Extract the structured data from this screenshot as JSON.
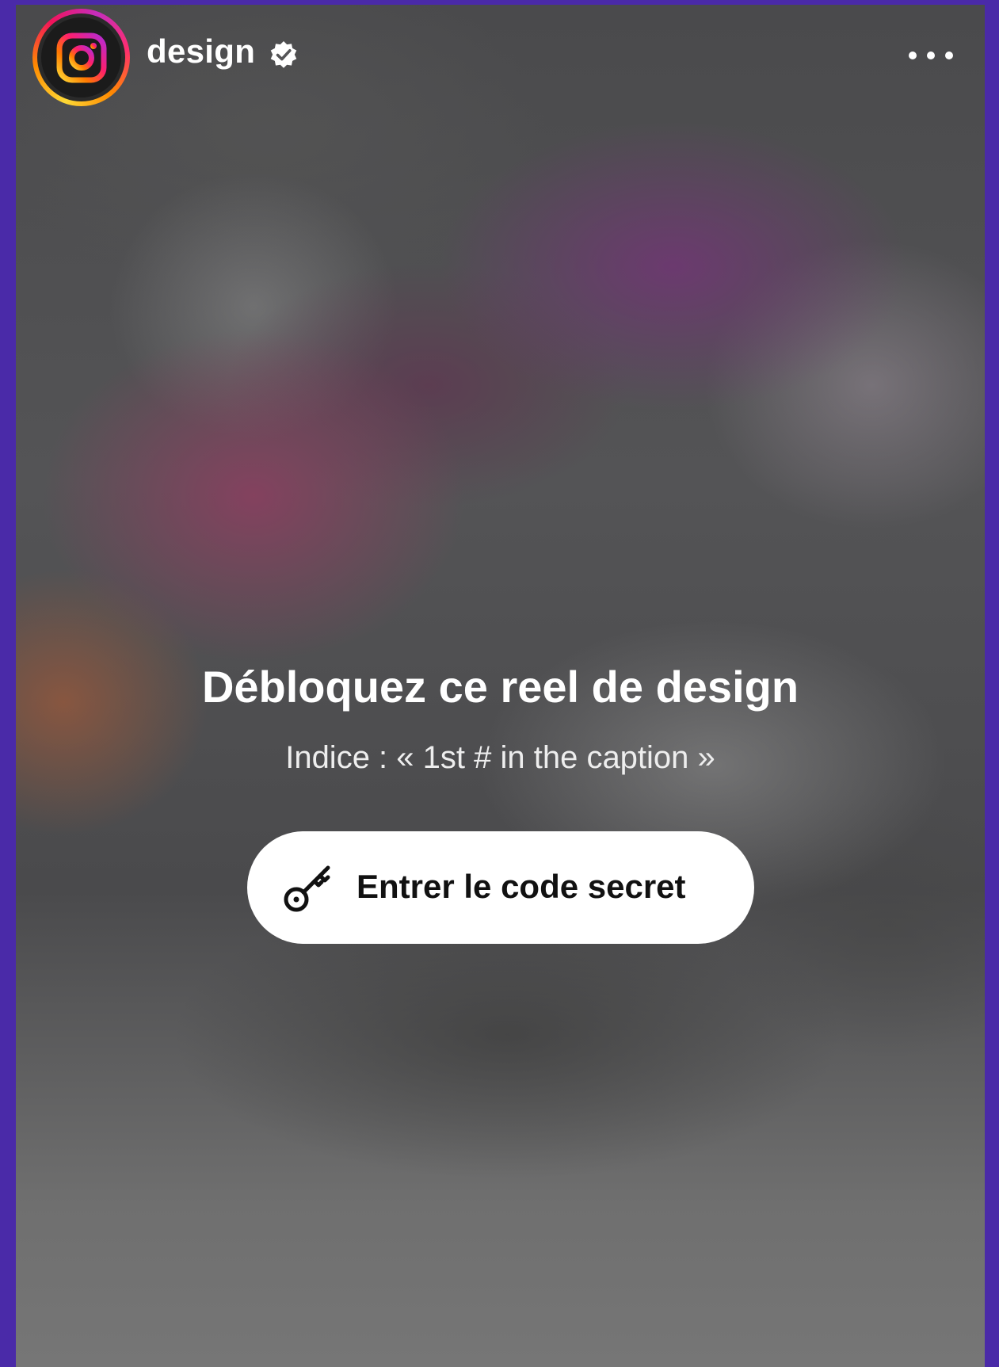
{
  "header": {
    "avatar_icon": "instagram-logo-icon",
    "username": "design",
    "verified_icon": "verified-badge-icon",
    "more_icon": "more-options-icon"
  },
  "locked_reel": {
    "title": "Débloquez ce reel de design",
    "hint": "Indice : « 1st # in the caption »",
    "button": {
      "icon": "key-icon",
      "label": "Entrer le code secret"
    }
  },
  "colors": {
    "frame": "#4a2aa8",
    "button_bg": "#ffffff",
    "text": "#ffffff"
  }
}
